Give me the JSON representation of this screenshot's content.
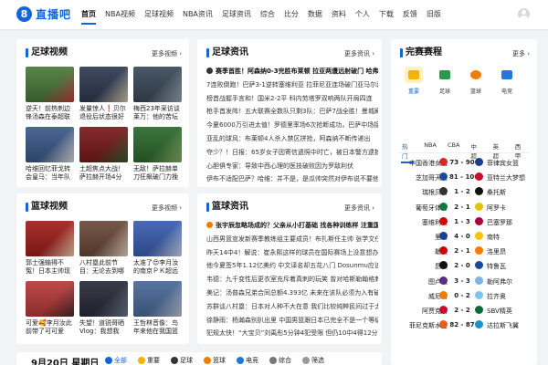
{
  "logo": {
    "mark": "8",
    "text": "直播吧"
  },
  "nav": [
    "首页",
    "NBA视频",
    "足球视频",
    "NBA资讯",
    "足球资讯",
    "综合",
    "比分",
    "数据",
    "资料",
    "个人",
    "下载",
    "反馈",
    "旧版"
  ],
  "football_video": {
    "title": "足球视频",
    "more": "更多视频 ›",
    "items": [
      {
        "title": "逆天！前热刺边锋汤森在泰超联赛打进"
      },
      {
        "title": "发量惊人❗贝尔退役后状态很好啊"
      },
      {
        "title": "梅西23年采访谈莱万：他的苦坛地位"
      },
      {
        "title": "哈维回忆菲戈转会皇马：当年队友都会"
      },
      {
        "title": "土超焦点大战！萨拉赫开场4分钟"
      },
      {
        "title": "无敌！萨拉赫单刀狂飙破门力挽狂澜"
      }
    ]
  },
  "football_news": {
    "title": "足球资讯",
    "more": "更多资讯 ›",
    "headline": "赛季首胜！阿森纳0-3完胜布莱顿 拉亚两遭远射破门 哈弗茨",
    "items": [
      "7连败倒跑！巴萨3-1逆转塞维利亚 拉菲尼亚连场破门亚马尔两",
      "榜首战握手言和！国米2-2平 科内劳塔罗双响两队开局四连",
      "枪手首发阵！五大联赛全数队只剩3队：巴萨7战全胜！曼城刷",
      "今夏6000万引进太值！罗德里率场6次抢断成功，巴萨中场接",
      "亚乱的球风：布莱顿4人杀入禁区拼抢，阿森纳不断传递出",
      "夺少？！日报：65岁女子因寄信遗照中时亡，被日本警方逮捕",
      "心胆俱专家：导致中西心理的医技破败因为罗敌利伏",
      "伊布不适配巴萨？哈维：并不是，是瓜帅突然对伊布说不要他了"
    ]
  },
  "match": {
    "title": "完赛赛程",
    "more": "更多 ›",
    "categories": [
      {
        "label": "重要",
        "icon": "trophy-icon"
      },
      {
        "label": "足球",
        "icon": "football-pitch-icon"
      },
      {
        "label": "篮球",
        "icon": "basketball-icon"
      },
      {
        "label": "电竞",
        "icon": "gamepad-icon"
      }
    ],
    "tabs": [
      "热门",
      "NBA",
      "CBA",
      "中超",
      "英超",
      "西甲"
    ],
    "rows": [
      {
        "home": "中国香港女篮",
        "score": "73 - 90",
        "away": "菲律宾女篮",
        "hc": "#d42a2a",
        "ac": "#1b3c8c"
      },
      {
        "home": "芝加哥天空",
        "score": "81 - 106",
        "away": "亚特兰大梦想",
        "hc": "#1a4a9a",
        "ac": "#c8102e"
      },
      {
        "home": "瑞根贝雷",
        "score": "1 - 2",
        "away": "桑托斯",
        "hc": "#333333",
        "ac": "#111111"
      },
      {
        "home": "葡萄牙体育",
        "score": "2 - 1",
        "away": "阿罗卡",
        "hc": "#0a7a3e",
        "ac": "#e3c400"
      },
      {
        "home": "塞维利亚",
        "score": "1 - 3",
        "away": "巴塞罗那",
        "hc": "#d40000",
        "ac": "#a50044"
      },
      {
        "home": "里昂",
        "score": "4 - 0",
        "away": "南特",
        "hc": "#1c3f94",
        "ac": "#f5c400"
      },
      {
        "home": "勒沃",
        "score": "2 - 1",
        "away": "洛里昂",
        "hc": "#d00000",
        "ac": "#f57c00"
      },
      {
        "home": "昂热",
        "score": "2 - 0",
        "away": "特鲁瓦",
        "hc": "#111111",
        "ac": "#1a4a9a"
      },
      {
        "home": "图卢兹",
        "score": "3 - 3",
        "away": "勒阿弗尔",
        "hc": "#5e2d82",
        "ac": "#7fb3e6"
      },
      {
        "home": "威尼斯",
        "score": "0 - 2",
        "away": "拉齐奥",
        "hc": "#f07c00",
        "ac": "#7cc3eb"
      },
      {
        "home": "阿贾克斯",
        "score": "2 - 2",
        "away": "SBV精英",
        "hc": "#c8102e",
        "ac": "#0b6b37"
      },
      {
        "home": "菲尼克斯水星",
        "score": "82 - 87",
        "away": "达拉斯飞翼",
        "hc": "#e56020",
        "ac": "#1e90c8"
      }
    ]
  },
  "basketball_video": {
    "title": "篮球视频",
    "more": "更多视频 ›",
    "items": [
      {
        "title": "郭士强输得不冤！日本主帅现场怒斥"
      },
      {
        "title": "八村塁此前节目：无论去到哪里，我"
      },
      {
        "title": "太准了😍李月汝的南京ＰＫ超远"
      },
      {
        "title": "可爱🥰李月汝此前带了可可爱"
      },
      {
        "title": "失望！道锐哥晒Vlog：我想我"
      },
      {
        "title": "王哲林音像：鸟年来他在我国篮坛"
      }
    ]
  },
  "basketball_news": {
    "title": "篮球资讯",
    "more": "更多资讯 ›",
    "headline": "张宇辰忽略场成的？父亲从小打基础 找各种训练样 注重国",
    "items": [
      "山西男篮宣发新赛季教练组主要成员！布扎斯任主帅 张学文任助",
      "昨天14中4！解说：崔永熙这样的球员在国际赛场上没意想办",
      "他今夏签5年1.12亿美约 中文译名却五花八门 Dosunmu应该叫",
      "韦德：九千变性后更衣室充斥着真刺的玩笑 曾对哈斯勒翰格刺",
      "美记：汤普森兄弟合同总额4.393亿 未来在该队必须为入有破成",
      "苏群谈八村塁：日本对人种不大在意 我们比较纯粹民间过于太美",
      "徐静雨：杨瀚森别扒出里 中国男篮跟日本已完全不是一个等级",
      "犯规太快！“大宝贝”刘禹彤5分钟4犯受限 但仍10中4得12分5板"
    ]
  },
  "bottom": {
    "date": "9月20日 星期日",
    "filters": [
      "全部",
      "重要",
      "足球",
      "篮球",
      "电竞",
      "综合",
      "筛选"
    ]
  }
}
